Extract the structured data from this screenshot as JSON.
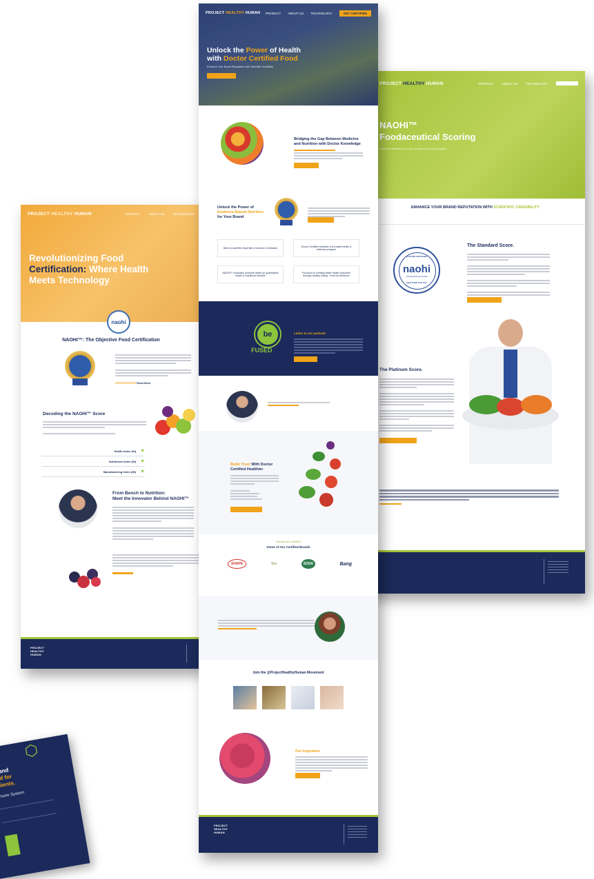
{
  "brand": {
    "logo_project": "PROJECT",
    "logo_healthy": "HEALTHY",
    "logo_human": "HUMAN",
    "navy": "#1b2a5a",
    "orange": "#f0a319",
    "green": "#a6c63a"
  },
  "nav": {
    "products": "PRODUCT",
    "about": "ABOUT US",
    "technology": "TECHNOLOGY",
    "button": "GET CERTIFIED"
  },
  "left": {
    "hero_title_1": "Revolutionizing Food",
    "hero_title_2": "Certification:",
    "hero_title_3": "Where Health",
    "hero_title_4": "Meets Technology",
    "section_title": "NAOHI™: The Objective Food Certification",
    "read_more": "Read More",
    "decoding_title": "Decoding the NAOHI™ Score",
    "accordion": [
      "Health Index (HI)",
      "Nutritional Index (NI)",
      "Manufacturing Index (MI)"
    ],
    "innovator_title_1": "From Bench to Nutrition:",
    "innovator_title_2": "Meet the Innovator Behind NAOHI™"
  },
  "center": {
    "hero_title_1": "Unlock the",
    "hero_title_power": "Power",
    "hero_title_2": "of Health",
    "hero_title_3": "with",
    "hero_title_food": "Doctor Certified Food",
    "hero_sub": "Enhance Your Brand Reputation with Scientific Credibility",
    "bridge_title_1": "Bridging the Gap Between Medicine",
    "bridge_title_2": "and Nutrition with Doctor Knowledge",
    "unlock_title_1": "Unlock the Power of",
    "unlock_title_2": "Evidence-Based Nutrition",
    "unlock_title_3": "for Your Brand",
    "cards": [
      "Built on scientific expertise of doctors & clinicians",
      "Doctor Certified Healthier is a trusted health & wellness program",
      "NAOHI™ evaluates products based on quantitative health & nutritional benefits",
      "Focused on creating better health outcomes through healthy eating - Food As Medicine"
    ],
    "podcast_title": "Listen to our podcast",
    "podcast_logo_be": "be",
    "podcast_logo_fused": "FUSED",
    "build_title_orange": "Build Trust",
    "build_title_1": "With Doctor",
    "build_title_2": "Certified Healthier",
    "brands_kicker": "Brands We Certified",
    "brands_title": "Some of Our Certified Brands",
    "brand_logos": [
      "SHAPE",
      "Tea",
      "SODA",
      "Bang"
    ],
    "join_title": "Join the @ProjectHealthyHuman Movement",
    "inspiration_title": "Our Inspiration"
  },
  "right": {
    "hero_title_1": "NAOHI™",
    "hero_title_2": "Foodaceutical Scoring",
    "hero_sub": "Learn the differences of our proprietary scoring system",
    "enhance_1": "ENHANCE YOUR BRAND REPUTATION WITH",
    "enhance_2": "SCIENTIFIC CREDIBILITY",
    "standard_title": "The Standard Score.",
    "seal_top": "DOCTOR CERTIFIED",
    "seal_name": "naohi",
    "seal_bottom": "HEALTHIER FOR YOU",
    "seal_mid": "FOODACEUTICAL SCORE",
    "platinum_title": "The Platinum Score."
  },
  "brochure": {
    "line1": "re and",
    "line2": "and for",
    "line3": "edients.",
    "line4": "mune System"
  }
}
